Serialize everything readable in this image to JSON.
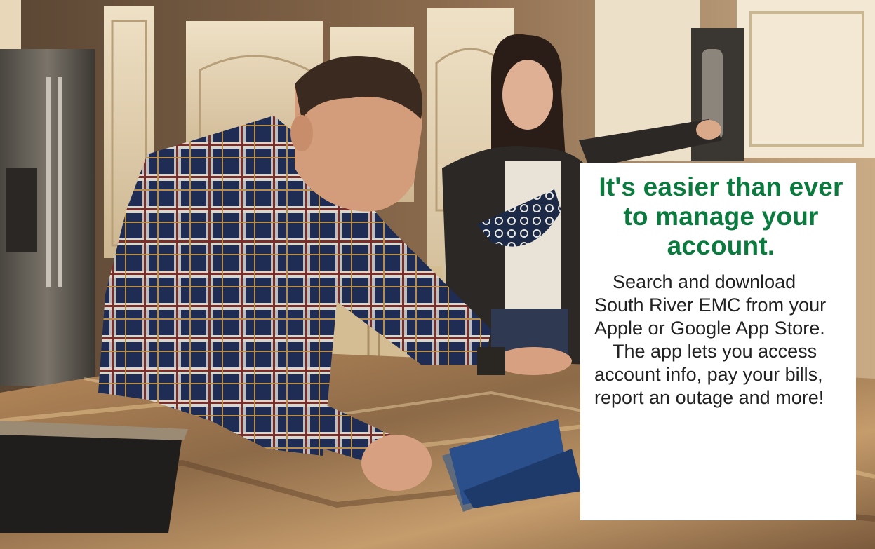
{
  "ad": {
    "headline": "It's easier than ever to manage your account.",
    "paragraphs": [
      "Search and download South River EMC from your Apple or Google App Store.",
      "The app lets you access account info, pay your bills, report an outage and more!"
    ]
  },
  "colors": {
    "headline": "#0b7a3e",
    "body_text": "#222222",
    "panel": "#ffffff"
  }
}
